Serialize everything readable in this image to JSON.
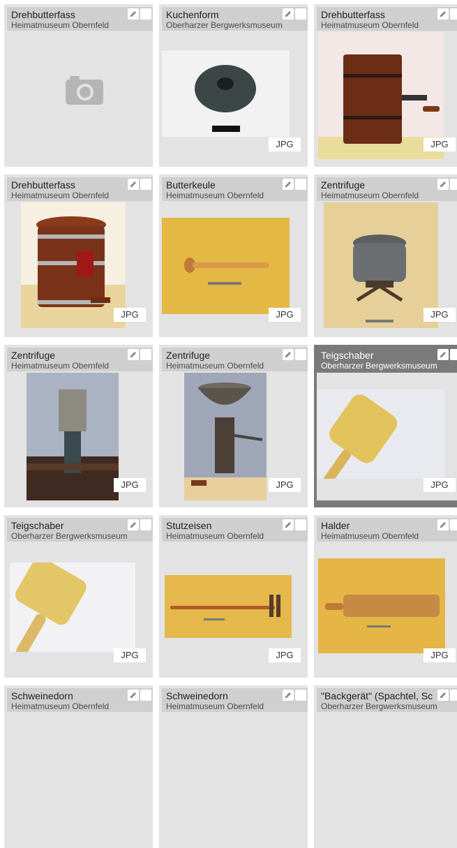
{
  "cards": [
    {
      "title": "Drehbutterfass",
      "museum": "Heimatmuseum Obernfeld",
      "badge": ""
    },
    {
      "title": "Kuchenform",
      "museum": "Oberharzer Bergwerksmuseum",
      "badge": "JPG"
    },
    {
      "title": "Drehbutterfass",
      "museum": "Heimatmuseum Obernfeld",
      "badge": "JPG"
    },
    {
      "title": "Drehbutterfass",
      "museum": "Heimatmuseum Obernfeld",
      "badge": "JPG"
    },
    {
      "title": "Butterkeule",
      "museum": "Heimatmuseum Obernfeld",
      "badge": "JPG"
    },
    {
      "title": "Zentrifuge",
      "museum": "Heimatmuseum Obernfeld",
      "badge": "JPG"
    },
    {
      "title": "Zentrifuge",
      "museum": "Heimatmuseum Obernfeld",
      "badge": "JPG"
    },
    {
      "title": "Zentrifuge",
      "museum": "Heimatmuseum Obernfeld",
      "badge": "JPG"
    },
    {
      "title": "Teigschaber",
      "museum": "Oberharzer Bergwerksmuseum",
      "badge": "JPG"
    },
    {
      "title": "Teigschaber",
      "museum": "Oberharzer Bergwerksmuseum",
      "badge": "JPG"
    },
    {
      "title": "Stutzeisen",
      "museum": "Heimatmuseum Obernfeld",
      "badge": "JPG"
    },
    {
      "title": "Halder",
      "museum": "Heimatmuseum Obernfeld",
      "badge": "JPG"
    },
    {
      "title": "Schweinedorn",
      "museum": "Heimatmuseum Obernfeld",
      "badge": ""
    },
    {
      "title": "Schweinedorn",
      "museum": "Heimatmuseum Obernfeld",
      "badge": ""
    },
    {
      "title": "\"Backgerät\" (Spachtel, Sc",
      "museum": "Oberharzer Bergwerksmuseum",
      "badge": ""
    }
  ],
  "colors": {
    "card_bg": "#e3e3e3",
    "header_bg": "#cfcfcf",
    "selected_bg": "#7a7a7a"
  }
}
